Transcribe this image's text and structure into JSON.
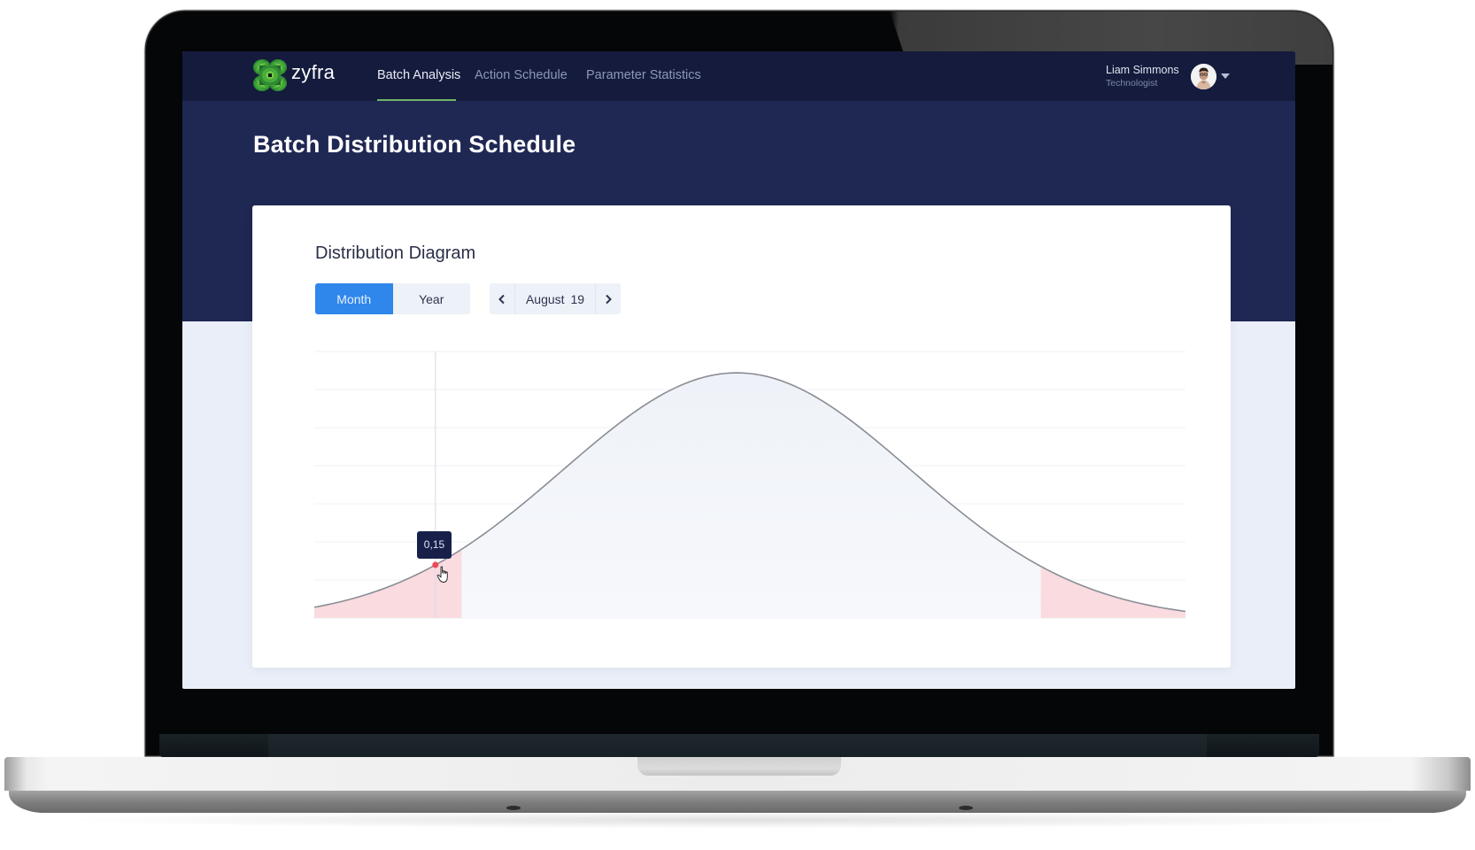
{
  "navbar": {
    "brand": "zyfra",
    "logo_icon": "clover-logo-icon",
    "items": [
      {
        "label": "Batch Analysis",
        "active": true
      },
      {
        "label": "Action Schedule",
        "active": false
      },
      {
        "label": "Parameter Statistics",
        "active": false
      }
    ],
    "accent_color": "#72b36a",
    "user": {
      "name": "Liam Simmons",
      "role": "Technologist",
      "menu_icon": "chevron-down-icon"
    }
  },
  "page": {
    "title": "Batch Distribution Schedule"
  },
  "card": {
    "title": "Distribution Diagram",
    "period_toggle": [
      {
        "label": "Month",
        "active": true
      },
      {
        "label": "Year",
        "active": false
      }
    ],
    "date_nav": {
      "prev_icon": "chevron-left-icon",
      "label": "August  19",
      "next_icon": "chevron-right-icon"
    }
  },
  "colors": {
    "primary": "#2f86eb",
    "navbar": "#141b3d",
    "band": "#1f2853",
    "highlight_region": "#f9dbe0",
    "marker": "#ee4a55"
  },
  "chart_data": {
    "type": "area",
    "title": "",
    "xlabel": "",
    "ylabel": "",
    "distribution": "normal",
    "x_range": [
      0,
      1
    ],
    "ylim": [
      0,
      1
    ],
    "grid": true,
    "gridline_count": 8,
    "curve": {
      "peak_x": 0.485,
      "peak_y": 0.92,
      "sigma": 0.2,
      "edge_y": 0.025
    },
    "highlight_regions": [
      {
        "from": 0,
        "to": 0.169,
        "label": "lower tail"
      },
      {
        "from": 0.834,
        "to": 1,
        "label": "upper tail"
      }
    ],
    "hover": {
      "x": 0.139,
      "value_label": "0,15"
    }
  }
}
